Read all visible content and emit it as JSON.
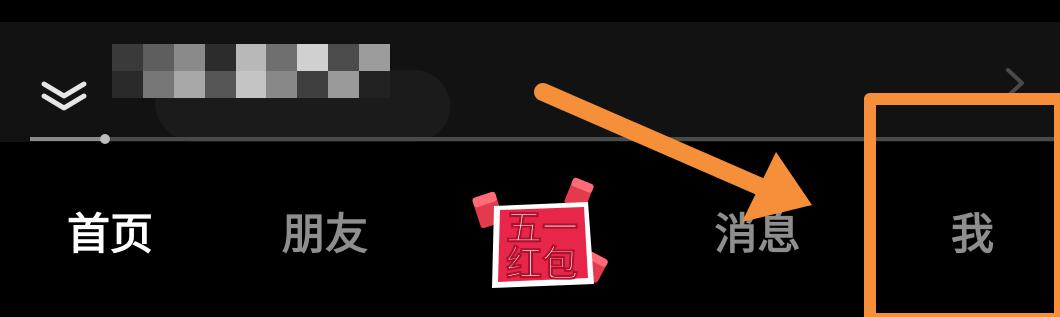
{
  "player": {
    "collapse_icon": "chevron-double-down-icon",
    "expand_icon": "chevron-right-icon",
    "title_visible": "口",
    "progress": 0.07
  },
  "tabs": [
    {
      "id": "home",
      "label": "首页",
      "active": true
    },
    {
      "id": "friends",
      "label": "朋友",
      "active": false
    },
    {
      "id": "promo",
      "label": "五一红包",
      "active": false
    },
    {
      "id": "messages",
      "label": "消息",
      "active": false
    },
    {
      "id": "me",
      "label": "我",
      "active": false
    }
  ],
  "promo": {
    "line1": "五一",
    "line2": "红包",
    "color": "#e8264a",
    "text_color": "#ffffff"
  },
  "colors": {
    "background": "#000000",
    "active_tab": "#ffffff",
    "inactive_tab": "#8e8e8e",
    "annotation": "#f58f3a"
  }
}
